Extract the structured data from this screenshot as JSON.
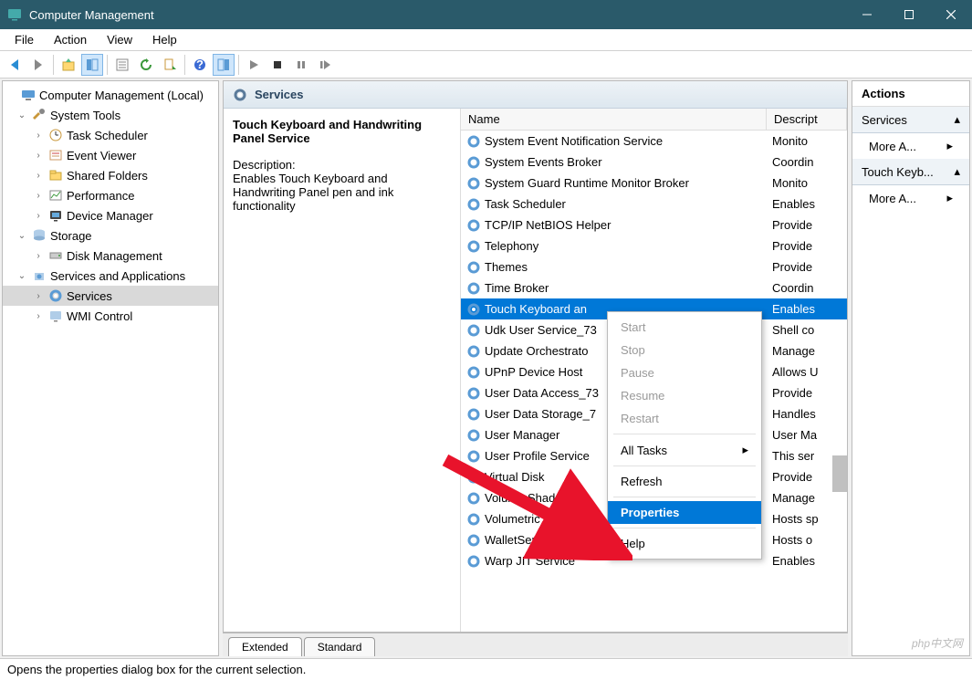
{
  "window": {
    "title": "Computer Management"
  },
  "menubar": [
    "File",
    "Action",
    "View",
    "Help"
  ],
  "tree": {
    "root": "Computer Management (Local)",
    "systools": "System Tools",
    "systools_children": [
      "Task Scheduler",
      "Event Viewer",
      "Shared Folders",
      "Performance",
      "Device Manager"
    ],
    "storage": "Storage",
    "storage_children": [
      "Disk Management"
    ],
    "svcapps": "Services and Applications",
    "svcapps_children": [
      "Services",
      "WMI Control"
    ]
  },
  "center": {
    "header": "Services",
    "detail_title": "Touch Keyboard and Handwriting Panel Service",
    "detail_desc_label": "Description:",
    "detail_desc": "Enables Touch Keyboard and Handwriting Panel pen and ink functionality",
    "cols": {
      "name": "Name",
      "desc": "Descript"
    },
    "services": [
      {
        "n": "System Event Notification Service",
        "d": "Monito"
      },
      {
        "n": "System Events Broker",
        "d": "Coordin"
      },
      {
        "n": "System Guard Runtime Monitor Broker",
        "d": "Monito"
      },
      {
        "n": "Task Scheduler",
        "d": "Enables"
      },
      {
        "n": "TCP/IP NetBIOS Helper",
        "d": "Provide"
      },
      {
        "n": "Telephony",
        "d": "Provide"
      },
      {
        "n": "Themes",
        "d": "Provide"
      },
      {
        "n": "Time Broker",
        "d": "Coordin"
      },
      {
        "n": "Touch Keyboard an",
        "d": "Enables",
        "sel": true
      },
      {
        "n": "Udk User Service_73",
        "d": "Shell co"
      },
      {
        "n": "Update Orchestrato",
        "d": "Manage"
      },
      {
        "n": "UPnP Device Host",
        "d": "Allows U"
      },
      {
        "n": "User Data Access_73",
        "d": "Provide"
      },
      {
        "n": "User Data Storage_7",
        "d": "Handles"
      },
      {
        "n": "User Manager",
        "d": "User Ma"
      },
      {
        "n": "User Profile Service",
        "d": "This ser"
      },
      {
        "n": "Virtual Disk",
        "d": "Provide"
      },
      {
        "n": "Volume Shadow Co",
        "d": "Manage"
      },
      {
        "n": "Volumetric Audi",
        "d": "Hosts sp"
      },
      {
        "n": "WalletService",
        "d": "Hosts o"
      },
      {
        "n": "Warp JIT Service",
        "d": "Enables"
      }
    ],
    "tabs": [
      "Extended",
      "Standard"
    ]
  },
  "context_menu": {
    "items": [
      {
        "label": "Start",
        "disabled": true
      },
      {
        "label": "Stop",
        "disabled": true
      },
      {
        "label": "Pause",
        "disabled": true
      },
      {
        "label": "Resume",
        "disabled": true
      },
      {
        "label": "Restart",
        "disabled": true
      },
      {
        "sep": true
      },
      {
        "label": "All Tasks",
        "submenu": true
      },
      {
        "sep": true
      },
      {
        "label": "Refresh"
      },
      {
        "sep": true
      },
      {
        "label": "Properties",
        "highlight": true
      },
      {
        "sep": true
      },
      {
        "label": "Help"
      }
    ]
  },
  "actions": {
    "header": "Actions",
    "sec1": "Services",
    "item1": "More A...",
    "sec2": "Touch Keyb...",
    "item2": "More A..."
  },
  "statusbar": "Opens the properties dialog box for the current selection.",
  "watermark": "php中文网"
}
